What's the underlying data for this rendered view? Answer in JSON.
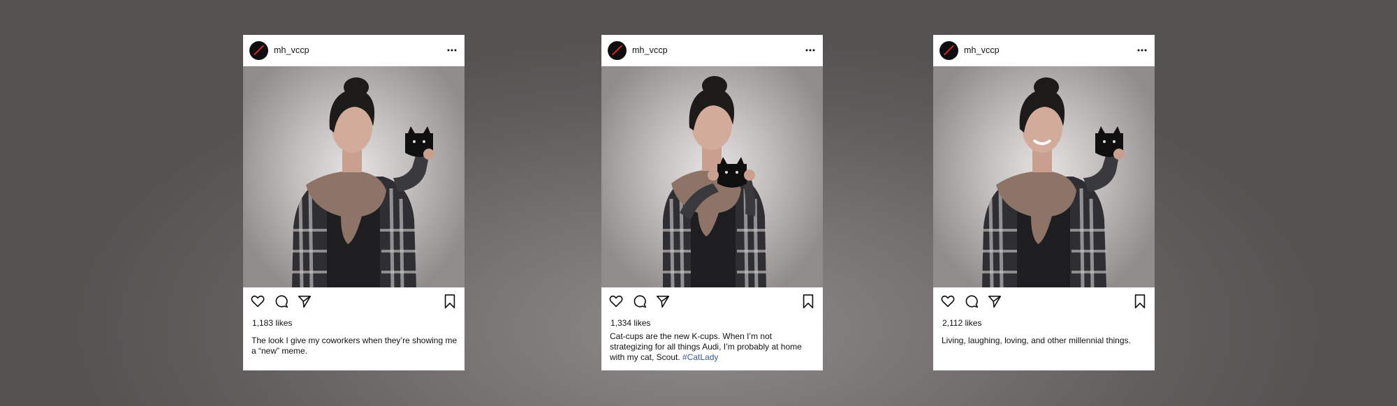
{
  "colors": {
    "background": "#6e6b6b",
    "card": "#ffffff",
    "text": "#111111",
    "hashtag": "#3b5b8a",
    "avatar_bg": "#0e0e10",
    "avatar_slash": "#d9262c"
  },
  "icons": {
    "more": "more-horizontal-icon",
    "like": "heart-icon",
    "comment": "comment-icon",
    "share": "send-icon",
    "save": "bookmark-icon"
  },
  "posts": [
    {
      "username": "mh_vccp",
      "likes": "1,183 likes",
      "caption": "The look I give my coworkers when they’re showing me a “new” meme.",
      "hashtag": ""
    },
    {
      "username": "mh_vccp",
      "likes": "1,334 likes",
      "caption": "Cat-cups are the new K-cups. When I’m not strategizing for all things Audi, I’m probably at home with my cat, Scout.",
      "hashtag": "#CatLady"
    },
    {
      "username": "mh_vccp",
      "likes": "2,112 likes",
      "caption": "Living, laughing, loving, and other millennial things.",
      "hashtag": ""
    }
  ]
}
